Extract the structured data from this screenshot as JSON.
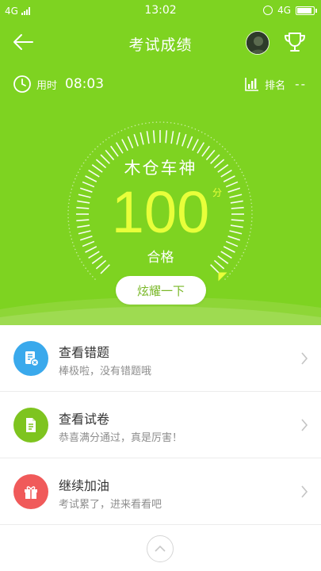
{
  "status_bar": {
    "network_left": "4G",
    "time": "13:02",
    "network_right": "4G",
    "alarm_icon": "alarm-icon",
    "battery_icon": "battery-icon"
  },
  "nav": {
    "title": "考试成绩",
    "back_icon": "back-arrow-icon",
    "trophy_icon": "trophy-icon"
  },
  "stats": {
    "time_label": "用时",
    "time_value": "08:03",
    "rank_label": "排名",
    "rank_value": "--"
  },
  "result": {
    "title": "木仓车神",
    "score": "100",
    "score_unit": "分",
    "status": "合格",
    "share_label": "炫耀一下",
    "score_fraction": 1.0
  },
  "list": [
    {
      "title": "查看错题",
      "subtitle": "棒极啦，没有错题哦",
      "icon": "wrong-questions-icon",
      "icon_color": "#3aa9ec"
    },
    {
      "title": "查看试卷",
      "subtitle": "恭喜满分通过，真是厉害！",
      "icon": "exam-paper-icon",
      "icon_color": "#7ec41f"
    },
    {
      "title": "继续加油",
      "subtitle": "考试累了，进来看看吧",
      "icon": "gift-icon",
      "icon_color": "#f05a5a"
    }
  ],
  "colors": {
    "hero_green": "#7ed321",
    "score_yellow": "#e8ff3a"
  }
}
